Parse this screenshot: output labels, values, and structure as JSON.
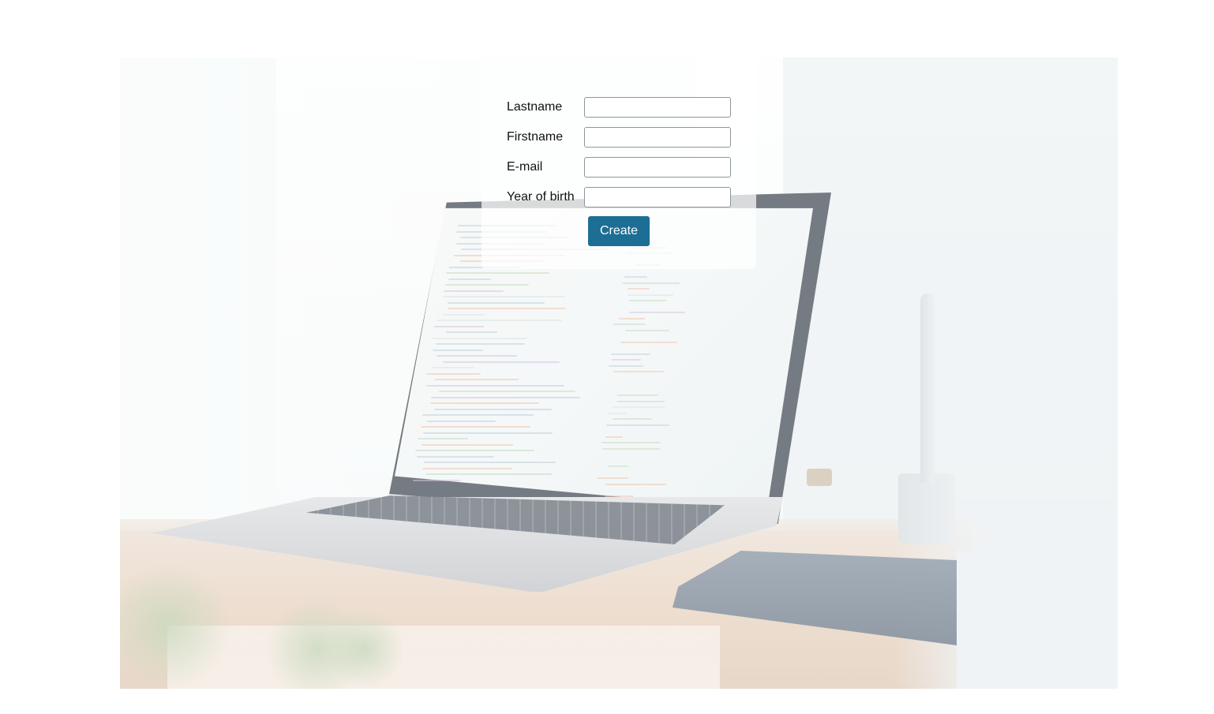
{
  "form": {
    "fields": [
      {
        "label": "Lastname",
        "value": "",
        "placeholder": ""
      },
      {
        "label": "Firstname",
        "value": "",
        "placeholder": ""
      },
      {
        "label": "E-mail",
        "value": "",
        "placeholder": ""
      },
      {
        "label": "Year of birth",
        "value": "",
        "placeholder": ""
      }
    ],
    "submit_label": "Create"
  },
  "colors": {
    "button": "#1d6e95",
    "button_text": "#ffffff",
    "page_background": "#ffffff"
  }
}
